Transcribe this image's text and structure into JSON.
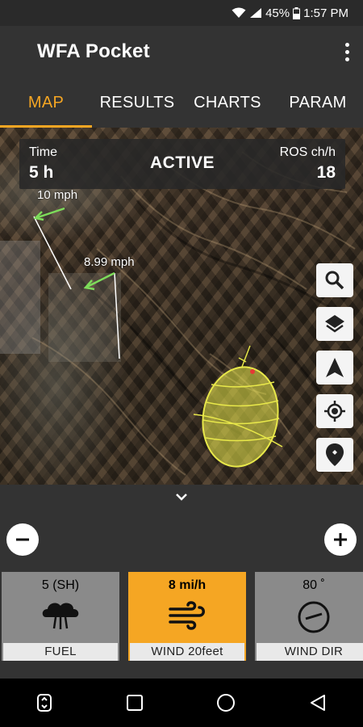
{
  "status_bar": {
    "battery": "45%",
    "time": "1:57 PM"
  },
  "app": {
    "title": "WFA Pocket"
  },
  "tabs": [
    {
      "label": "MAP",
      "active": true
    },
    {
      "label": "RESULTS",
      "active": false
    },
    {
      "label": "CHARTS",
      "active": false
    },
    {
      "label": "PARAM",
      "active": false
    }
  ],
  "info_panel": {
    "time_label": "Time",
    "time_value": "5 h",
    "status": "ACTIVE",
    "ros_label": "ROS ch/h",
    "ros_value": "18"
  },
  "map": {
    "wind_labels": [
      "10 mph",
      "8.99 mph"
    ],
    "buttons": [
      "search-icon",
      "layers-icon",
      "navigation-icon",
      "my-location-icon",
      "place-marker-icon"
    ]
  },
  "inputs": [
    {
      "value": "5 (SH)",
      "label": "FUEL",
      "icon": "fuel-cloud-icon",
      "active": false
    },
    {
      "value": "8 mi/h",
      "label": "WIND 20feet",
      "icon": "wind-icon",
      "active": true
    },
    {
      "value": "80 ˚",
      "label": "WIND DIR",
      "icon": "compass-icon",
      "active": false
    }
  ],
  "colors": {
    "accent": "#f5a623",
    "fire_fill": "#e8e84a",
    "wind_arrow": "#7ddc5a"
  }
}
